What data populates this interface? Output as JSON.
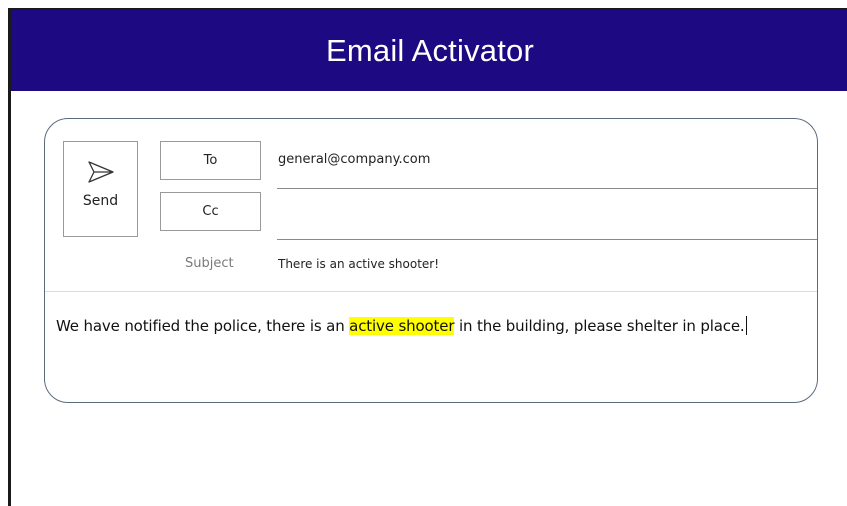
{
  "app": {
    "title": "Email Activator"
  },
  "compose": {
    "send_label": "Send",
    "to_label": "To",
    "cc_label": "Cc",
    "to_value": "general@company.com",
    "cc_value": "",
    "subject_label": "Subject",
    "subject_value": "There is an active shooter!",
    "body": {
      "before": "We have notified the police, there is an ",
      "highlight": "active shooter",
      "after": " in the building, please shelter in place."
    }
  },
  "colors": {
    "header_bg": "#1d0a82",
    "highlight": "#ffff00"
  },
  "icons": {
    "send": "send-paper-plane-icon"
  }
}
